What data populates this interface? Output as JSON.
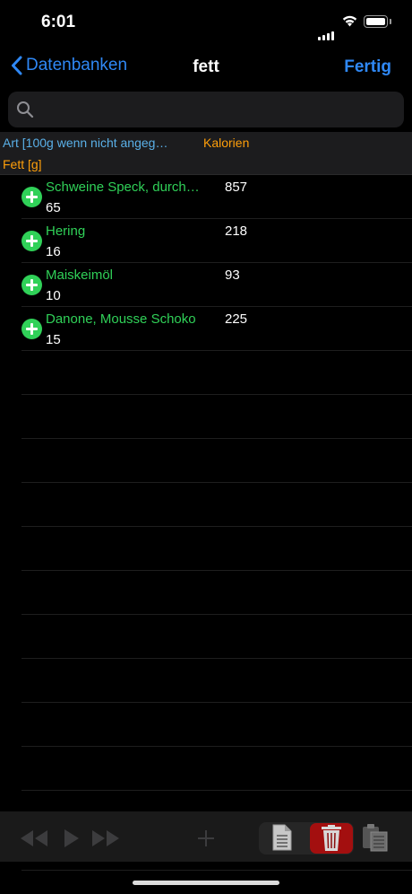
{
  "status": {
    "time": "6:01"
  },
  "nav": {
    "back_label": "Datenbanken",
    "title": "fett",
    "done_label": "Fertig"
  },
  "search": {
    "placeholder": "",
    "value": ""
  },
  "header": {
    "col1": "Art [100g wenn nicht angeg…",
    "col2": "Kalorien",
    "col3": "Fett [g]"
  },
  "rows": [
    {
      "name": "Schweine Speck, durch…",
      "kalorien": "857",
      "fett": "65"
    },
    {
      "name": "Hering",
      "kalorien": "218",
      "fett": "16"
    },
    {
      "name": "Maiskeimöl",
      "kalorien": "93",
      "fett": "10"
    },
    {
      "name": "Danone, Mousse Schoko",
      "kalorien": "225",
      "fett": "15"
    }
  ],
  "colors": {
    "accent": "#2f88f5",
    "green": "#30d158",
    "orange": "#ff9f0a",
    "header_blue": "#5ab0e8",
    "trash": "#a30f0f"
  }
}
